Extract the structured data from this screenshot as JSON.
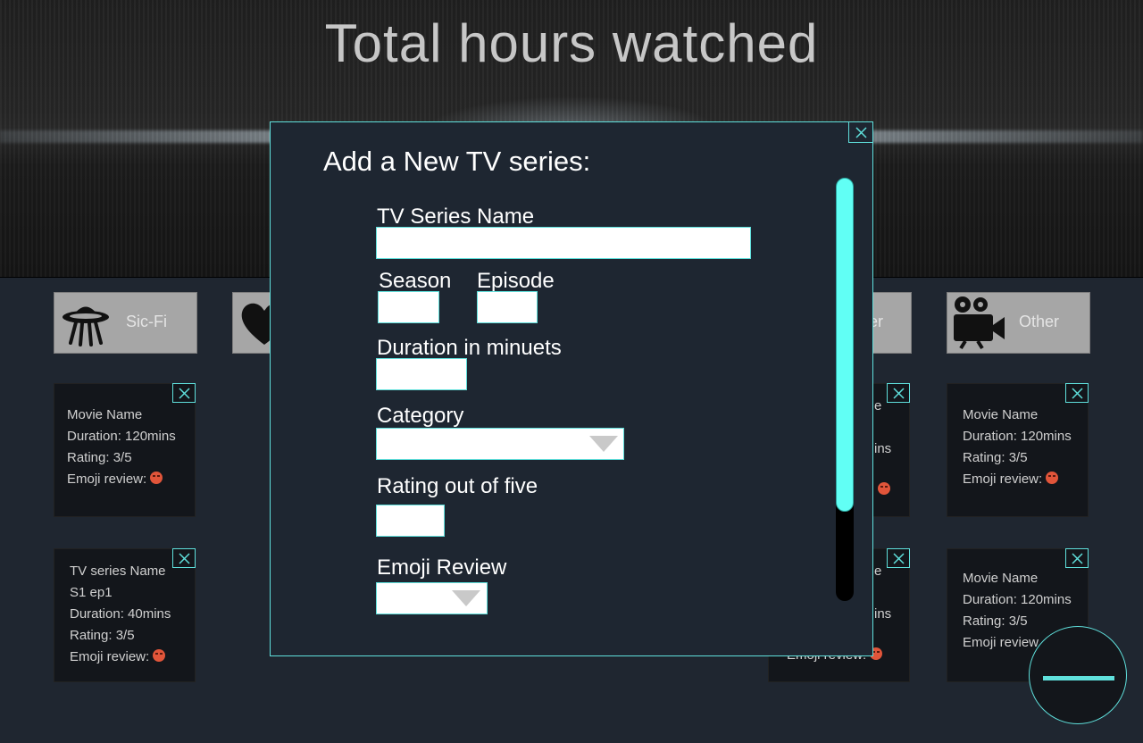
{
  "header": {
    "title": "Total hours watched"
  },
  "categories": [
    {
      "label": "Sic-Fi",
      "icon": "ufo-icon"
    },
    {
      "label": "",
      "icon": "heart-icon"
    },
    {
      "label": "ler",
      "icon": "knife-icon"
    },
    {
      "label": "Other",
      "icon": "movie-camera-icon"
    }
  ],
  "cards": {
    "c1": {
      "name": "Movie Name",
      "duration": "Duration: 120mins",
      "rating": "Rating: 3/5",
      "emoji": "Emoji review:"
    },
    "c2": {
      "name": "TV series Name",
      "episode": "S1 ep1",
      "duration": "Duration: 40mins",
      "rating": "Rating: 3/5",
      "emoji": "Emoji review:"
    },
    "c3": {
      "name": "Movie Name",
      "duration": "Duration: 120mins",
      "rating": "Rating: 3/5",
      "emoji": "Emoji review:"
    },
    "c4": {
      "name": "Movie Name",
      "duration": "Duration: 120mins",
      "rating": "Rating: 3/5",
      "emoji": "Emoji review"
    },
    "p1": {
      "l1": "e",
      "l3": "ins"
    },
    "p2": {
      "l1": "e",
      "l3": "ins",
      "l4": "Emoji review:"
    }
  },
  "modal": {
    "title": "Add a New TV series:",
    "fields": {
      "series_name": {
        "label": "TV Series Name",
        "value": ""
      },
      "season": {
        "label": "Season",
        "value": ""
      },
      "episode": {
        "label": "Episode",
        "value": ""
      },
      "duration": {
        "label": "Duration in minuets",
        "value": ""
      },
      "category": {
        "label": "Category",
        "value": ""
      },
      "rating": {
        "label": "Rating out of five",
        "value": ""
      },
      "emoji": {
        "label": "Emoji Review",
        "value": ""
      }
    },
    "scroll_position": 0
  },
  "colors": {
    "accent": "#5fe0dc",
    "scroll": "#61fff5",
    "background": "#1f2630",
    "card": "#13161b"
  }
}
